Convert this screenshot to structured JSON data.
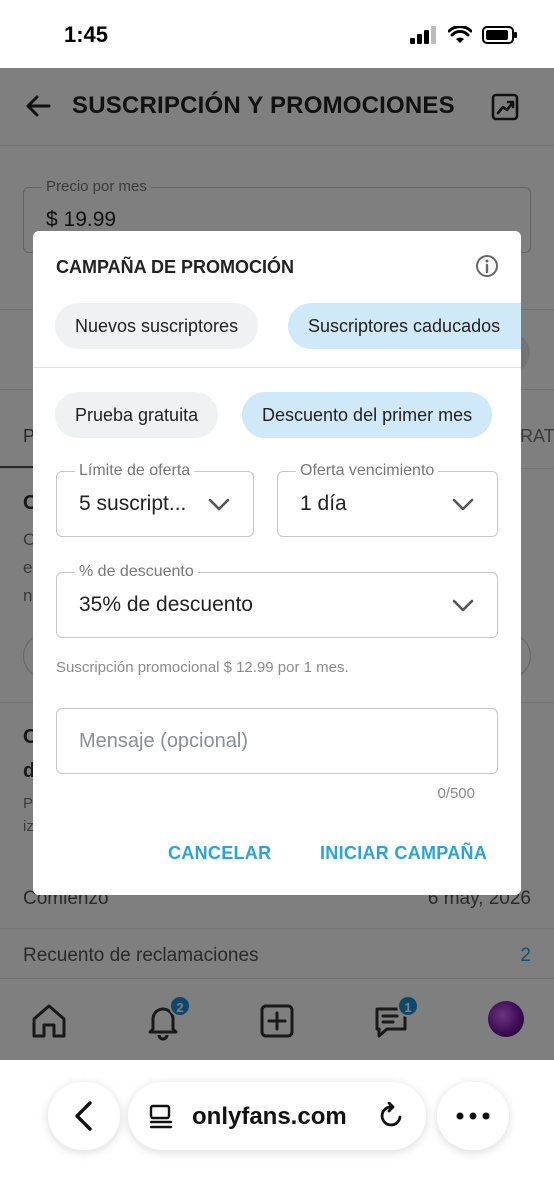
{
  "status_bar": {
    "time": "1:45"
  },
  "header": {
    "title": "SUSCRIPCIÓN Y PROMOCIONES"
  },
  "price": {
    "label": "Precio por mes",
    "value": "$ 19.99"
  },
  "background": {
    "tab_left": "P",
    "tab_right": "RAT",
    "c1": "C",
    "c2": "C",
    "e": "e",
    "n": "n",
    "c3": "C",
    "d": "d",
    "p": "P",
    "iz": "iz",
    "comienzo_label": "Comienzo",
    "comienzo_value": "6 may, 2026",
    "recuento_label": "Recuento de reclamaciones",
    "recuento_value": "2"
  },
  "bottom_nav": {
    "notifications_badge": "2",
    "messages_badge": "1"
  },
  "dialog": {
    "title": "CAMPAÑA DE PROMOCIÓN",
    "audience_options": [
      "Nuevos suscriptores",
      "Suscriptores caducados"
    ],
    "audience_selected": "Suscriptores caducados",
    "type_options": [
      "Prueba gratuita",
      "Descuento del primer mes"
    ],
    "type_selected": "Descuento del primer mes",
    "offer_limit": {
      "label": "Límite de oferta",
      "value": "5 suscript..."
    },
    "offer_expiry": {
      "label": "Oferta vencimiento",
      "value": "1 día"
    },
    "discount": {
      "label": "% de descuento",
      "value": "35% de descuento"
    },
    "helper": "Suscripción promocional $ 12.99 por 1 mes.",
    "message": {
      "placeholder": "Mensaje (opcional)",
      "counter": "0/500"
    },
    "cancel_label": "CANCELAR",
    "start_label": "INICIAR CAMPAÑA"
  },
  "browser": {
    "url": "onlyfans.com"
  },
  "colors": {
    "accent": "#2aa3dc",
    "chip_selected": "#cfe9f9",
    "chip_default": "#f0f1f3",
    "badge": "#1e8fd5"
  }
}
